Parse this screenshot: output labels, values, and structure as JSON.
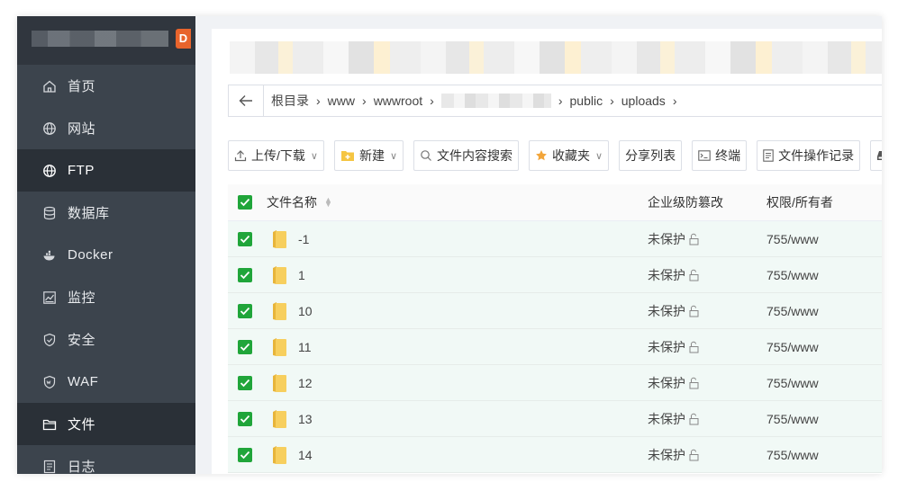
{
  "sidebar": {
    "items": [
      {
        "label": "首页",
        "icon": "home-icon",
        "active": false
      },
      {
        "label": "网站",
        "icon": "globe-icon",
        "active": false
      },
      {
        "label": "FTP",
        "icon": "ftp-globe-icon",
        "active": true
      },
      {
        "label": "数据库",
        "icon": "database-icon",
        "active": false
      },
      {
        "label": "Docker",
        "icon": "docker-icon",
        "active": false
      },
      {
        "label": "监控",
        "icon": "monitor-icon",
        "active": false
      },
      {
        "label": "安全",
        "icon": "shield-icon",
        "active": false
      },
      {
        "label": "WAF",
        "icon": "waf-shield-icon",
        "active": false
      },
      {
        "label": "文件",
        "icon": "folder-icon",
        "active": true
      },
      {
        "label": "日志",
        "icon": "log-icon",
        "active": false
      }
    ]
  },
  "breadcrumb": {
    "items": [
      "根目录",
      "www",
      "wwwroot",
      "",
      "public",
      "uploads"
    ]
  },
  "toolbar": {
    "upload_label": "上传/下载",
    "new_label": "新建",
    "search_label": "文件内容搜索",
    "favorites_label": "收藏夹",
    "share_label": "分享列表",
    "terminal_label": "终端",
    "oplog_label": "文件操作记录",
    "disk_label": "/"
  },
  "table": {
    "headers": {
      "name": "文件名称",
      "protect": "企业级防篡改",
      "perm": "权限/所有者"
    },
    "rows": [
      {
        "name": "-1",
        "protect": "未保护",
        "perm": "755/www"
      },
      {
        "name": "1",
        "protect": "未保护",
        "perm": "755/www"
      },
      {
        "name": "10",
        "protect": "未保护",
        "perm": "755/www"
      },
      {
        "name": "11",
        "protect": "未保护",
        "perm": "755/www"
      },
      {
        "name": "12",
        "protect": "未保护",
        "perm": "755/www"
      },
      {
        "name": "13",
        "protect": "未保护",
        "perm": "755/www"
      },
      {
        "name": "14",
        "protect": "未保护",
        "perm": "755/www"
      }
    ]
  },
  "colors": {
    "accent": "#20a53a",
    "sidebar_bg": "#3c444d",
    "sidebar_active": "#2a3037",
    "row_bg": "#f1f9f6",
    "folder": "#f5c542"
  }
}
